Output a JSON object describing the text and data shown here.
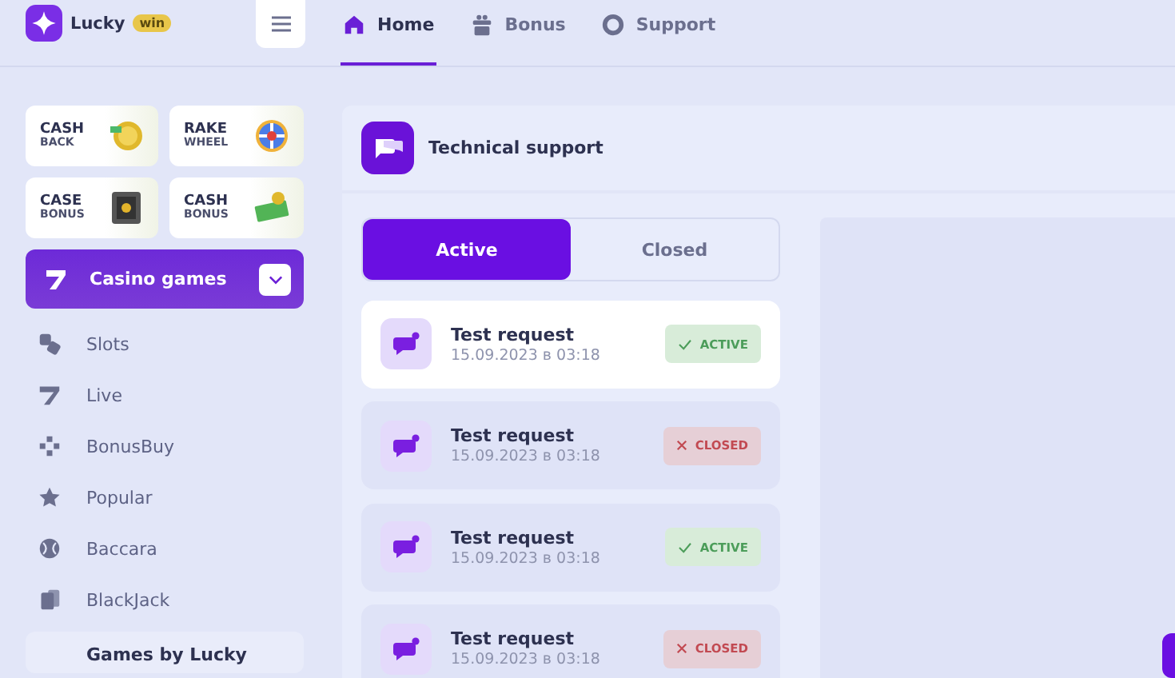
{
  "logo": {
    "name": "Lucky",
    "badge": "win"
  },
  "nav": [
    {
      "label": "Home",
      "selected": true
    },
    {
      "label": "Bonus",
      "selected": false
    },
    {
      "label": "Support",
      "selected": false
    }
  ],
  "promos": [
    {
      "line1": "CASH",
      "line2": "BACK"
    },
    {
      "line1": "RAKE",
      "line2": "WHEEL"
    },
    {
      "line1": "CASE",
      "line2": "BONUS"
    },
    {
      "line1": "CASH",
      "line2": "BONUS"
    }
  ],
  "category": {
    "label": "Casino games",
    "expanded": true
  },
  "menu": [
    {
      "label": "Slots"
    },
    {
      "label": "Live"
    },
    {
      "label": "BonusBuy"
    },
    {
      "label": "Popular"
    },
    {
      "label": "Baccara"
    },
    {
      "label": "BlackJack"
    }
  ],
  "games_by": {
    "label": "Games by Lucky"
  },
  "support": {
    "title": "Technical support",
    "tabs": [
      {
        "label": "Active",
        "selected": true
      },
      {
        "label": "Closed",
        "selected": false
      }
    ],
    "requests": [
      {
        "title": "Test request",
        "date": "15.09.2023 в 03:18",
        "kind": "active",
        "status_label": "ACTIVE",
        "selected": true
      },
      {
        "title": "Test request",
        "date": "15.09.2023 в 03:18",
        "kind": "closed",
        "status_label": "CLOSED",
        "selected": false
      },
      {
        "title": "Test request",
        "date": "15.09.2023 в 03:18",
        "kind": "active",
        "status_label": "ACTIVE",
        "selected": false
      },
      {
        "title": "Test request",
        "date": "15.09.2023 в 03:18",
        "kind": "closed",
        "status_label": "CLOSED",
        "selected": false
      }
    ]
  }
}
